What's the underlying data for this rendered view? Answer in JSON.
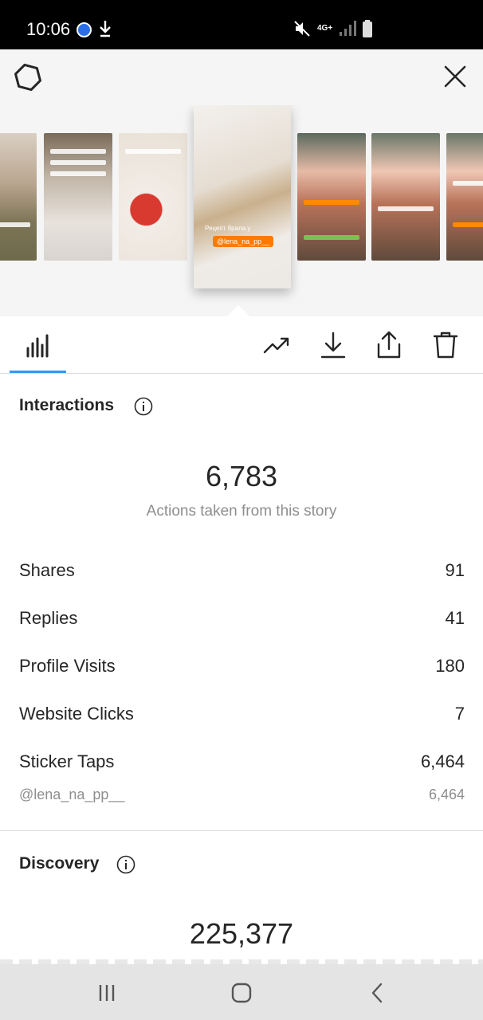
{
  "status_bar": {
    "time": "10:06",
    "network": "4G+",
    "icons": [
      "messenger-icon",
      "download-icon",
      "mute-icon",
      "signal-icon",
      "battery-icon"
    ]
  },
  "header": {
    "settings_icon": "gear-icon",
    "close_icon": "close-icon"
  },
  "thumbnails": {
    "active_caption": "Рецепт брала у",
    "active_mention": "@lena_na_pp__",
    "items": [
      "story-1",
      "story-2",
      "story-3",
      "story-4-active",
      "story-5",
      "story-6",
      "story-7"
    ]
  },
  "toolbar": {
    "tabs": [
      "insights-tab"
    ],
    "actions": [
      "promote-icon",
      "download-icon",
      "share-icon",
      "delete-icon"
    ]
  },
  "interactions": {
    "title": "Interactions",
    "total": "6,783",
    "caption": "Actions taken from this story",
    "rows": [
      {
        "label": "Shares",
        "value": "91"
      },
      {
        "label": "Replies",
        "value": "41"
      },
      {
        "label": "Profile Visits",
        "value": "180"
      },
      {
        "label": "Website Clicks",
        "value": "7"
      },
      {
        "label": "Sticker Taps",
        "value": "6,464"
      }
    ],
    "sticker_detail": {
      "label": "@lena_na_pp__",
      "value": "6,464"
    }
  },
  "discovery": {
    "title": "Discovery",
    "total": "225,377"
  },
  "colors": {
    "accent_blue": "#3897f0",
    "background_gray": "#f5f5f5",
    "text_dark": "#262626",
    "text_muted": "#8e8e8e"
  }
}
